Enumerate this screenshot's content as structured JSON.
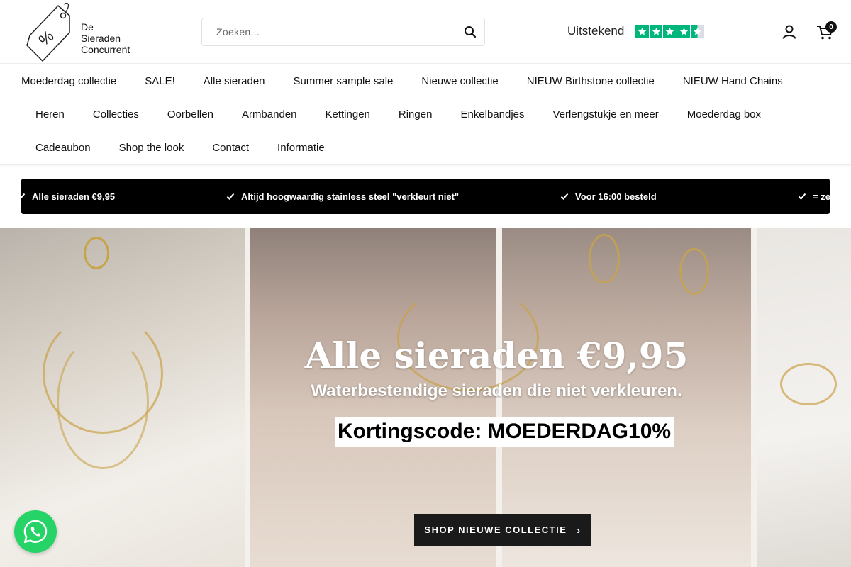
{
  "brand": {
    "logo_text_lines": [
      "De",
      "Sieraden",
      "Concurrent"
    ],
    "logo_tag_symbol": "%"
  },
  "search": {
    "placeholder": "Zoeken...",
    "icon": "search-icon"
  },
  "trustpilot": {
    "label": "Uitstekend",
    "rating_stars": 4.5,
    "star_color": "#00b67a"
  },
  "header_actions": {
    "account_icon": "user-icon",
    "cart_icon": "cart-icon",
    "cart_count": "0"
  },
  "nav": {
    "row1": [
      "Moederdag collectie",
      "SALE!",
      "Alle sieraden",
      "Summer sample sale",
      "Nieuwe collectie",
      "NIEUW Birthstone collectie",
      "NIEUW Hand Chains"
    ],
    "row2": [
      "Heren",
      "Collecties",
      "Oorbellen",
      "Armbanden",
      "Kettingen",
      "Ringen",
      "Enkelbandjes",
      "Verlengstukje en meer",
      "Moederdag box"
    ],
    "row3": [
      "Cadeaubon",
      "Shop the look",
      "Contact",
      "Informatie"
    ]
  },
  "usp_bar": {
    "background": "#000000",
    "items": [
      "Alle sieraden €9,95",
      "Altijd hoogwaardig stainless steel \"verkleurt niet\"",
      "Voor 16:00 besteld",
      "= ze"
    ]
  },
  "hero": {
    "title": "Alle sieraden €9,95",
    "subtitle": "Waterbestendige sieraden die niet verkleuren.",
    "code": "Kortingscode: MOEDERDAG10%",
    "button_label": "SHOP NIEUWE COLLECTIE"
  },
  "whatsapp": {
    "icon": "whatsapp-icon",
    "color": "#25d366"
  }
}
